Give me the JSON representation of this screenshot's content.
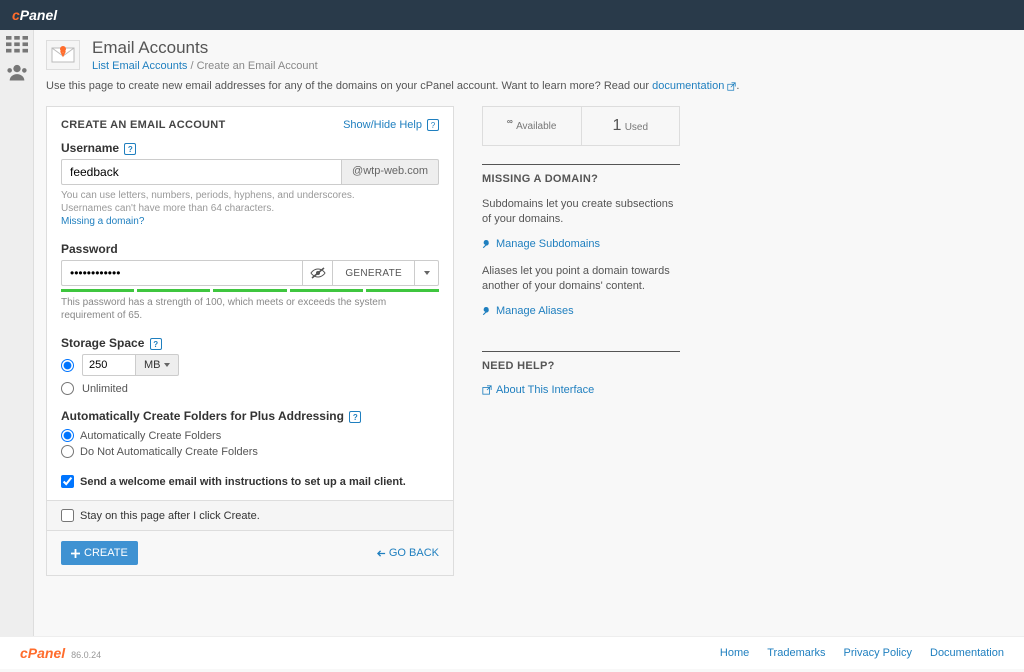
{
  "header": {
    "logo_prefix": "c",
    "logo_text": "Panel"
  },
  "page": {
    "title": "Email Accounts",
    "breadcrumb": {
      "link_text": "List Email Accounts",
      "sep": "/",
      "current": "Create an Email Account"
    },
    "intro_prefix": "Use this page to create new email addresses for any of the domains on your cPanel account. Want to learn more? Read our ",
    "intro_link": "documentation",
    "intro_suffix": "."
  },
  "form": {
    "heading": "CREATE AN EMAIL ACCOUNT",
    "help_toggle": "Show/Hide Help",
    "username": {
      "label": "Username",
      "value": "feedback",
      "domain": "@wtp-web.com",
      "hint1": "You can use letters, numbers, periods, hyphens, and underscores.",
      "hint2": "Usernames can't have more than 64 characters.",
      "missing_link": "Missing a domain?"
    },
    "password": {
      "label": "Password",
      "value": "••••••••••••",
      "generate": "GENERATE",
      "strength_msg": "This password has a strength of 100, which meets or exceeds the system requirement of 65."
    },
    "storage": {
      "label": "Storage Space",
      "value": "250",
      "unit": "MB",
      "unlimited_label": "Unlimited"
    },
    "plus_addressing": {
      "label": "Automatically Create Folders for Plus Addressing",
      "opt_auto": "Automatically Create Folders",
      "opt_no": "Do Not Automatically Create Folders"
    },
    "welcome_email": "Send a welcome email with instructions to set up a mail client.",
    "stay_on_page": "Stay on this page after I click Create.",
    "create_btn": "CREATE",
    "go_back": "GO BACK"
  },
  "sidebar": {
    "stats": {
      "available_num": "∞",
      "available_label": "Available",
      "used_num": "1",
      "used_label": "Used"
    },
    "missing": {
      "heading": "MISSING A DOMAIN?",
      "subdomains_text": "Subdomains let you create subsections of your domains.",
      "manage_subdomains": "Manage Subdomains",
      "aliases_text": "Aliases let you point a domain towards another of your domains' content.",
      "manage_aliases": "Manage Aliases"
    },
    "help": {
      "heading": "NEED HELP?",
      "about_link": "About This Interface"
    }
  },
  "footer": {
    "version": "86.0.24",
    "links": {
      "home": "Home",
      "trademarks": "Trademarks",
      "privacy": "Privacy Policy",
      "docs": "Documentation"
    }
  }
}
